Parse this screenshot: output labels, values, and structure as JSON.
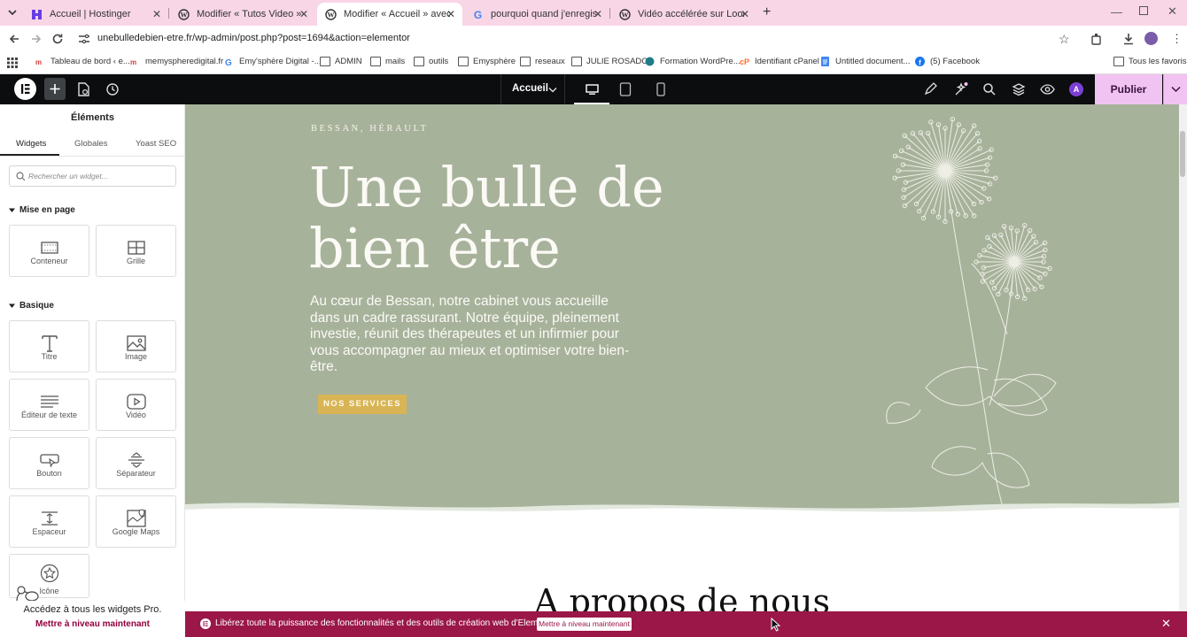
{
  "browser": {
    "tabs": [
      {
        "title": "Accueil | Hostinger"
      },
      {
        "title": "Modifier « Tutos Video » avec E"
      },
      {
        "title": "Modifier « Accueil » avec Eleme"
      },
      {
        "title": "pourquoi quand j'enregistre un"
      },
      {
        "title": "Vidéo accélérée sur Loom"
      }
    ],
    "url": "unebulledebien-etre.fr/wp-admin/post.php?post=1694&action=elementor",
    "bookmarks": [
      "Tableau de bord ‹ e...",
      "memyspheredigital.fr",
      "Emy'sphère Digital -...",
      "ADMIN",
      "mails",
      "outils",
      "Emysphère",
      "reseaux",
      "JULIE ROSADO",
      "Formation WordPre...",
      "Identifiant cPanel",
      "Untitled document...",
      "(5) Facebook"
    ],
    "all_bookmarks": "Tous les favoris"
  },
  "editor": {
    "page_select": "Accueil",
    "publish": "Publier",
    "avatar_letter": "A",
    "accent": "#f0c3f2"
  },
  "panel": {
    "title": "Éléments",
    "tabs": [
      "Widgets",
      "Globales",
      "Yoast SEO"
    ],
    "search_placeholder": "Rechercher un widget...",
    "section_layout": "Mise en page",
    "section_basic": "Basique",
    "layout_widgets": [
      "Conteneur",
      "Grille"
    ],
    "basic_widgets": [
      "Titre",
      "Image",
      "Éditeur de texte",
      "Vidéo",
      "Bouton",
      "Séparateur",
      "Espaceur",
      "Google Maps",
      "Icône"
    ],
    "pro_text": "Accédez à tous les widgets Pro.",
    "pro_link": "Mettre à niveau maintenant"
  },
  "page": {
    "eyebrow": "BESSAN, HÉRAULT",
    "hero_title_line1": "Une bulle de",
    "hero_title_line2": "bien être",
    "hero_text": "Au cœur de Bessan, notre cabinet vous accueille dans un cadre rassurant. Notre équipe, pleinement investie, réunit des thérapeutes et un infirmier pour vous accompagner au mieux et optimiser votre bien-être.",
    "cta": "NOS SERVICES",
    "about_title": "A propos de nous",
    "hero_color": "#a7b29b",
    "cta_color": "#d9b455"
  },
  "banner": {
    "text": "Libérez toute la puissance des fonctionnalités et des outils de création web d'Elementor.",
    "button": "Mettre à niveau maintenant",
    "color": "#9a1748"
  }
}
